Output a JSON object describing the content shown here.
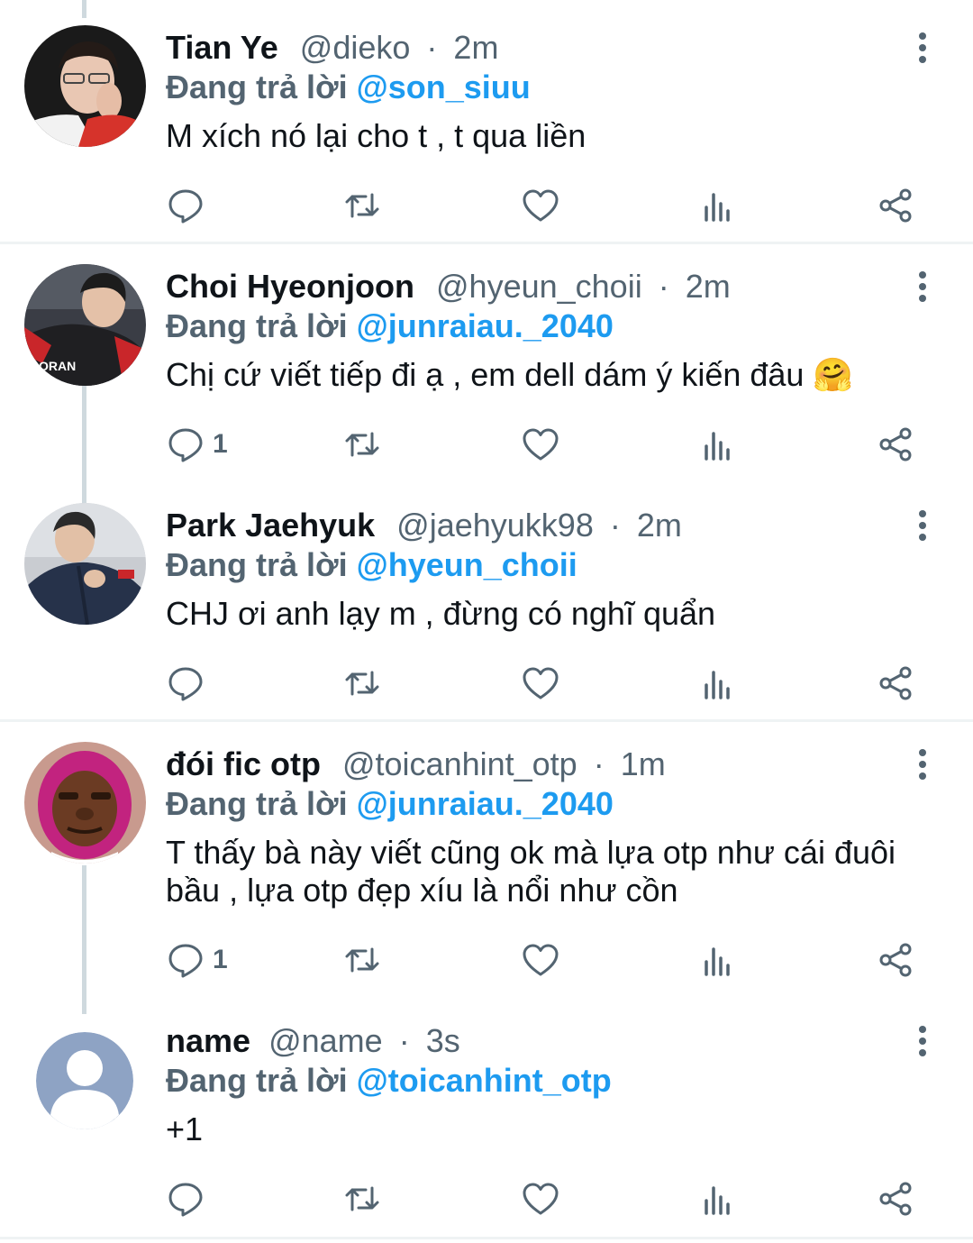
{
  "reply_prefix": "Đang trả lời",
  "tweets": [
    {
      "name": "Tian Ye",
      "handle": "@dieko",
      "dot": "·",
      "time": "2m",
      "reply_to": "@son_siuu",
      "text": "M xích nó lại cho t , t qua liền",
      "reply_count": ""
    },
    {
      "name": "Choi Hyeonjoon",
      "handle": "@hyeun_choii",
      "dot": "·",
      "time": "2m",
      "reply_to": "@junraiau._2040",
      "text": "Chị cứ viết tiếp đi ạ , em dell dám ý kiến đâu 🤗",
      "reply_count": "1"
    },
    {
      "name": "Park Jaehyuk",
      "handle": "@jaehyukk98",
      "dot": "·",
      "time": "2m",
      "reply_to": "@hyeun_choii",
      "text": "CHJ ơi anh lạy m , đừng có nghĩ quẩn",
      "reply_count": ""
    },
    {
      "name": "đói fic otp",
      "handle": "@toicanhint_otp",
      "dot": "·",
      "time": "1m",
      "reply_to": "@junraiau._2040",
      "text": "T thấy bà này viết cũng ok mà lựa otp như cái đuôi bầu , lựa otp đẹp xíu là nổi như cồn",
      "reply_count": "1"
    },
    {
      "name": "name",
      "handle": "@name",
      "dot": "·",
      "time": "3s",
      "reply_to": "@toicanhint_otp",
      "text": "+1",
      "reply_count": ""
    }
  ],
  "colors": {
    "text": "#0f1419",
    "secondary": "#536471",
    "mention": "#1d9bf0",
    "divider": "#eff3f4",
    "thread_line": "#cfd9de"
  },
  "icons": [
    "reply-icon",
    "retweet-icon",
    "like-icon",
    "views-icon",
    "share-icon",
    "more-options-icon"
  ]
}
